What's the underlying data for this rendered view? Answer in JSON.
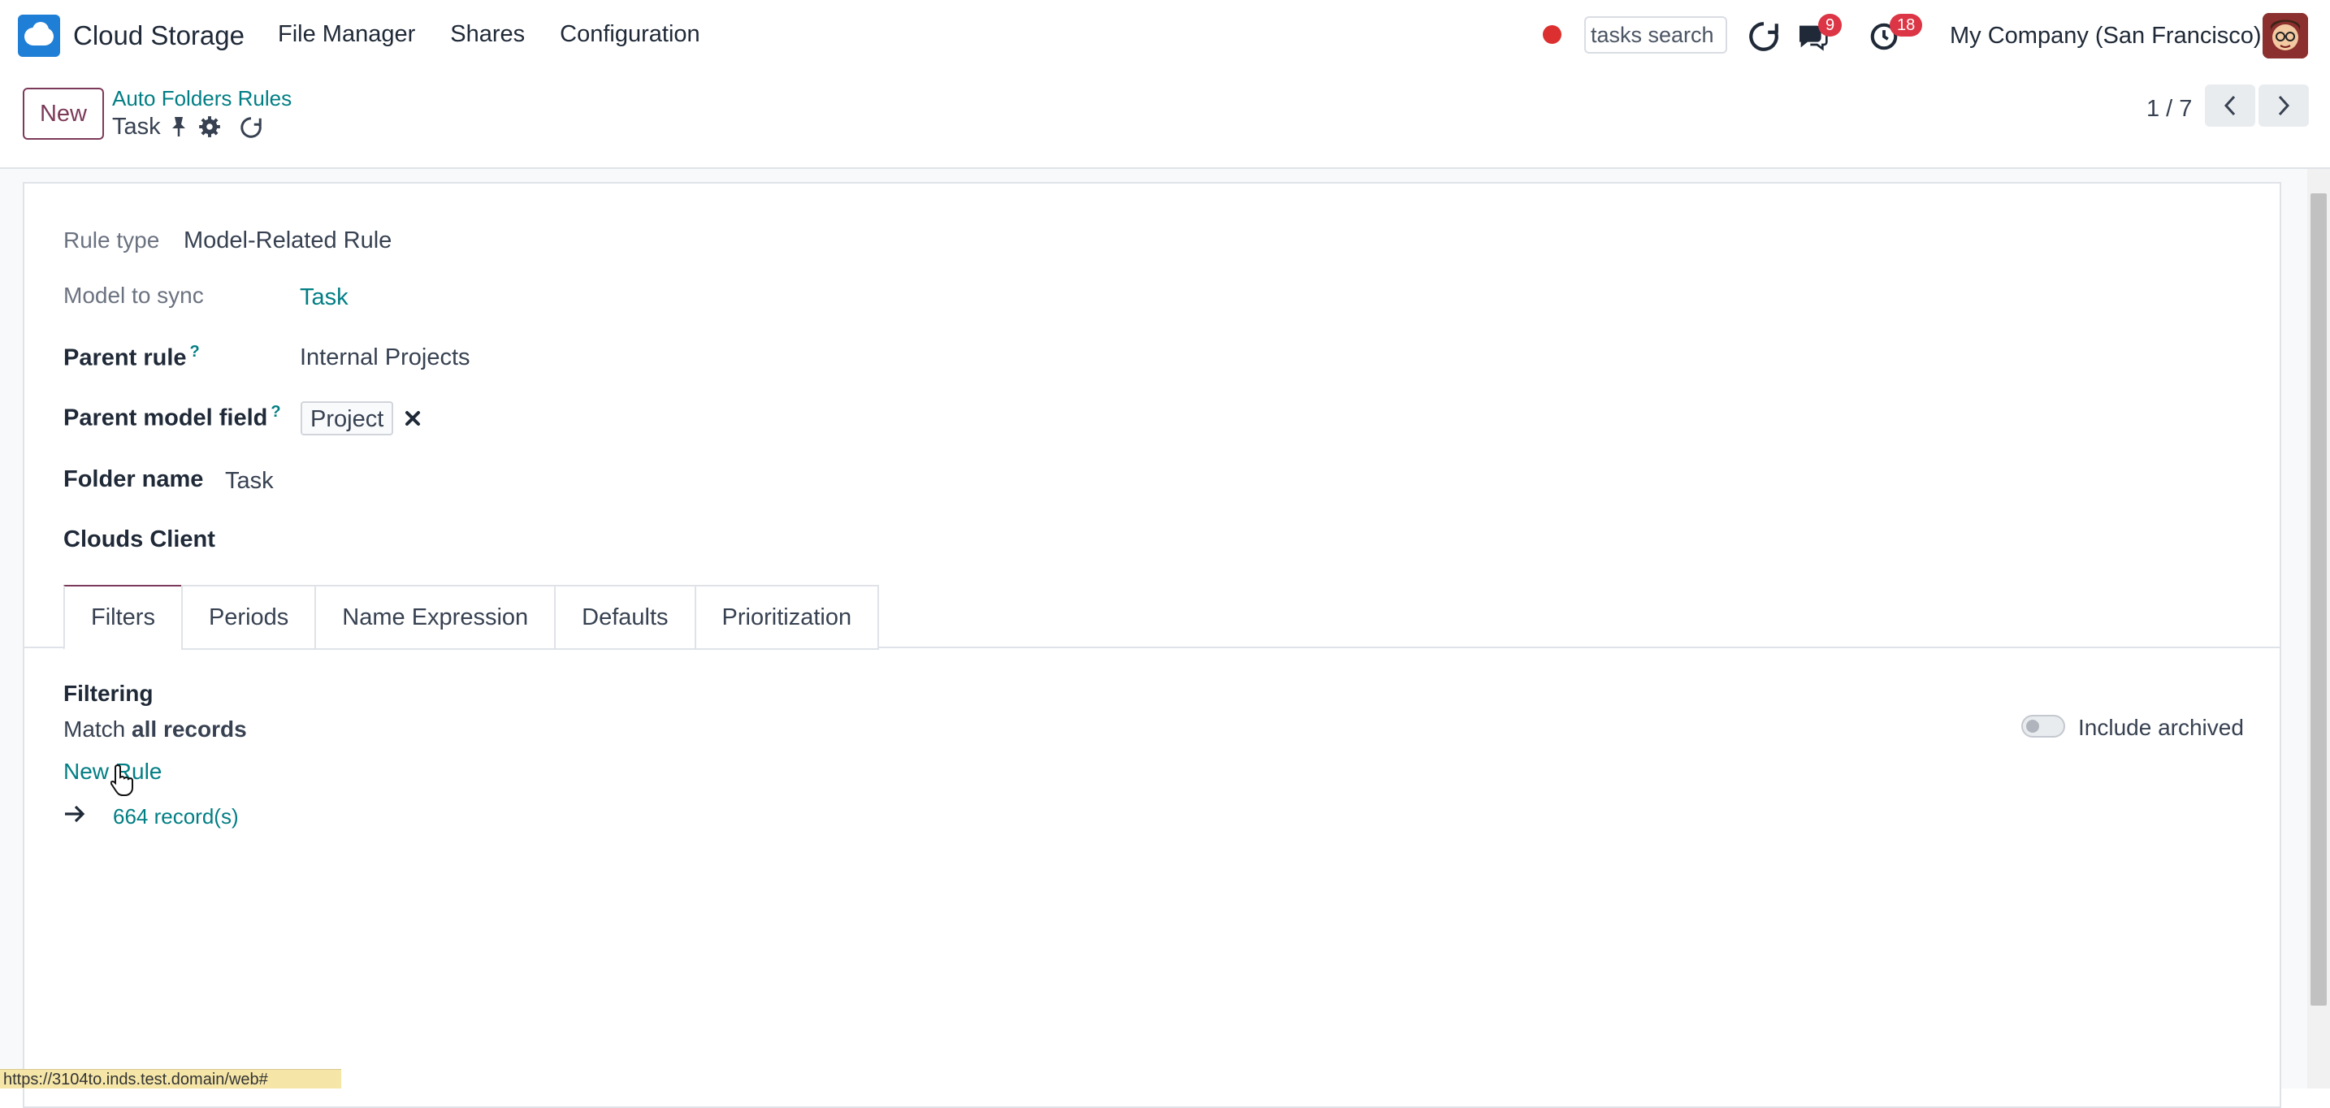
{
  "navbar": {
    "app_name": "Cloud Storage",
    "menu": [
      "File Manager",
      "Shares",
      "Configuration"
    ],
    "search_placeholder": "tasks search",
    "messages_count": "9",
    "activities_count": "18",
    "company": "My Company (San Francisco)",
    "recording_color": "#dc2f2f"
  },
  "control_panel": {
    "new_label": "New",
    "breadcrumb_parent": "Auto Folders Rules",
    "breadcrumb_current": "Task",
    "pager_value": "1 / 7"
  },
  "form": {
    "rule_type_label": "Rule type",
    "rule_type_value": "Model-Related Rule",
    "model_label": "Model to sync",
    "model_value": "Task",
    "parent_rule_label": "Parent rule",
    "parent_rule_value": "Internal Projects",
    "parent_field_label": "Parent model field",
    "parent_field_tag": "Project",
    "folder_name_label": "Folder name",
    "folder_name_value": "Task",
    "clouds_client_label": "Clouds Client",
    "help_mark": "?"
  },
  "tabs": [
    "Filters",
    "Periods",
    "Name Expression",
    "Defaults",
    "Prioritization"
  ],
  "filters": {
    "section_title": "Filtering",
    "match_prefix": "Match",
    "match_value": "all records",
    "new_rule": "New Rule",
    "records_link": "664 record(s)",
    "include_archived": "Include archived",
    "include_archived_on": false
  },
  "status_url": "https://3104to.inds.test.domain/web#"
}
